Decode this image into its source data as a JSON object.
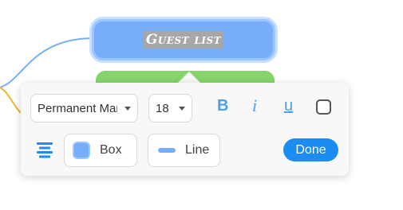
{
  "canvas": {
    "main_node_text": "Guest list",
    "main_node_color": "#78aef9",
    "sub_node_color": "#86d46a"
  },
  "toolbar": {
    "font_value": "Permanent Marker",
    "font_size": "18",
    "bold_label": "B",
    "italic_label": "i",
    "underline_label": "u",
    "box_label": "Box",
    "line_label": "Line",
    "done_label": "Done",
    "accent_color": "#1b8df2"
  }
}
